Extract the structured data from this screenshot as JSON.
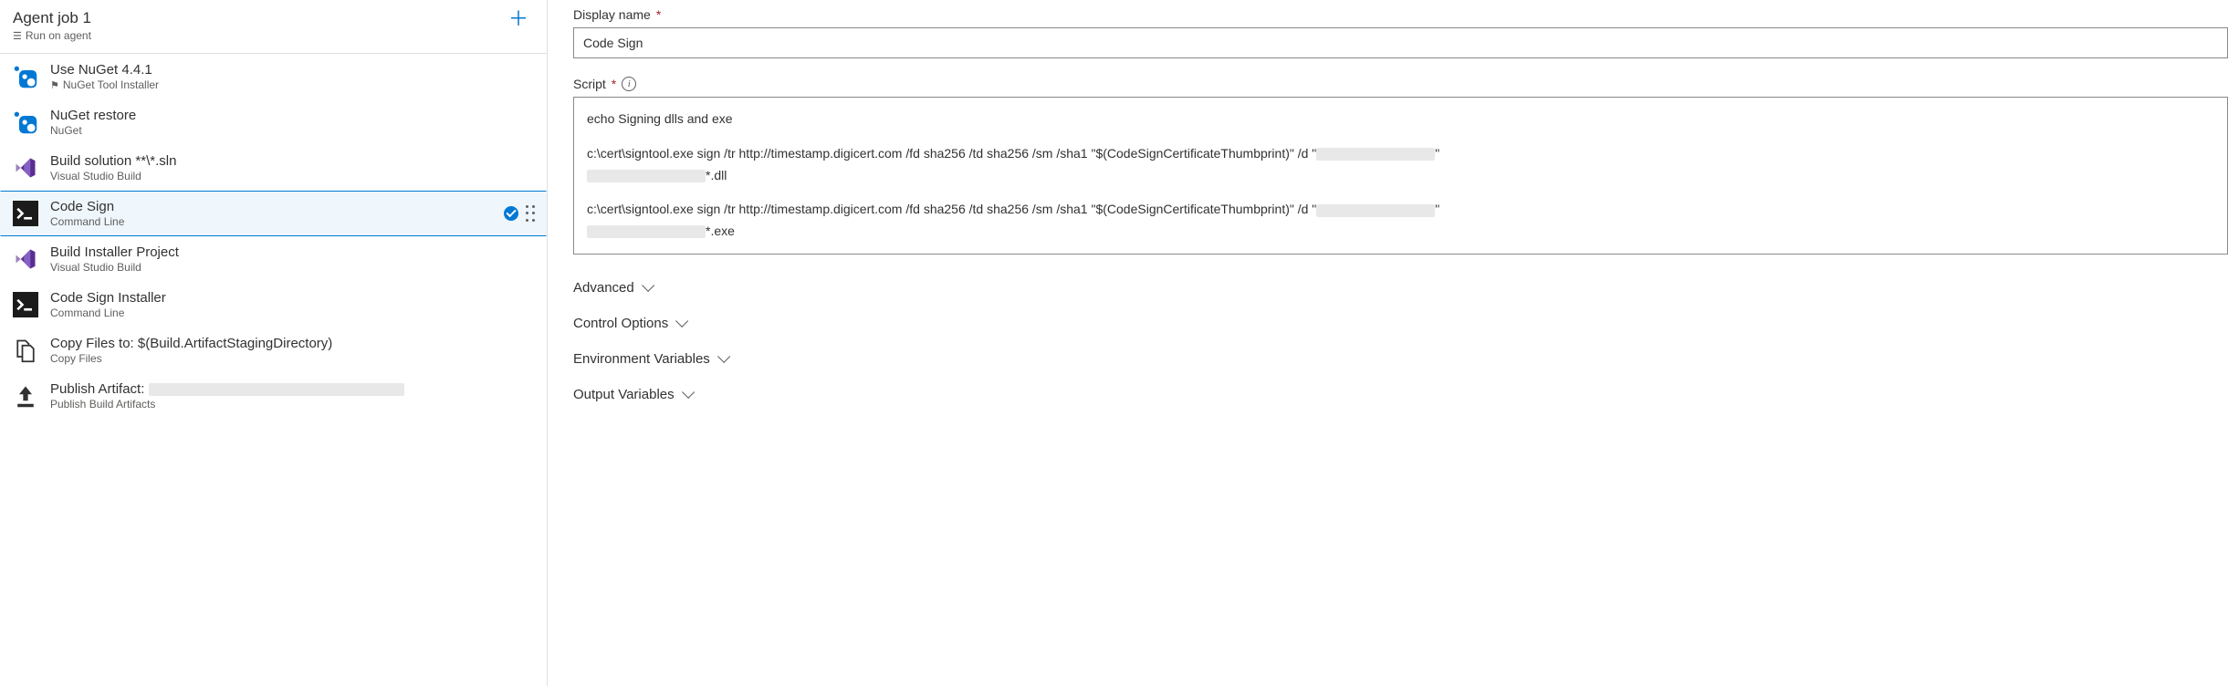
{
  "job": {
    "title": "Agent job 1",
    "subtitle": "Run on agent"
  },
  "tasks": [
    {
      "title": "Use NuGet 4.4.1",
      "subtitle": "NuGet Tool Installer",
      "icon": "nuget",
      "flag": true
    },
    {
      "title": "NuGet restore",
      "subtitle": "NuGet",
      "icon": "nuget"
    },
    {
      "title": "Build solution **\\*.sln",
      "subtitle": "Visual Studio Build",
      "icon": "vs"
    },
    {
      "title": "Code Sign",
      "subtitle": "Command Line",
      "icon": "cmd",
      "selected": true
    },
    {
      "title": "Build Installer Project",
      "subtitle": "Visual Studio Build",
      "icon": "vs"
    },
    {
      "title": "Code Sign Installer",
      "subtitle": "Command Line",
      "icon": "cmd"
    },
    {
      "title": "Copy Files to: $(Build.ArtifactStagingDirectory)",
      "subtitle": "Copy Files",
      "icon": "copy"
    },
    {
      "title": "Publish Artifact:",
      "subtitle": "Publish Build Artifacts",
      "icon": "publish",
      "redacted_suffix": true
    }
  ],
  "form": {
    "display_name_label": "Display name",
    "display_name_value": "Code Sign",
    "script_label": "Script",
    "script_lines": {
      "l1": "echo Signing dlls and exe",
      "l2a": "c:\\cert\\signtool.exe sign /tr http://timestamp.digicert.com /fd sha256 /td sha256 /sm /sha1 \"$(CodeSignCertificateThumbprint)\" /d \"",
      "l2b": "\"",
      "l2c": "*.dll",
      "l3a": "c:\\cert\\signtool.exe sign /tr http://timestamp.digicert.com /fd sha256 /td sha256 /sm /sha1 \"$(CodeSignCertificateThumbprint)\" /d \"",
      "l3b": "\"",
      "l3c": "*.exe"
    }
  },
  "sections": {
    "advanced": "Advanced",
    "control": "Control Options",
    "env": "Environment Variables",
    "output": "Output Variables"
  }
}
